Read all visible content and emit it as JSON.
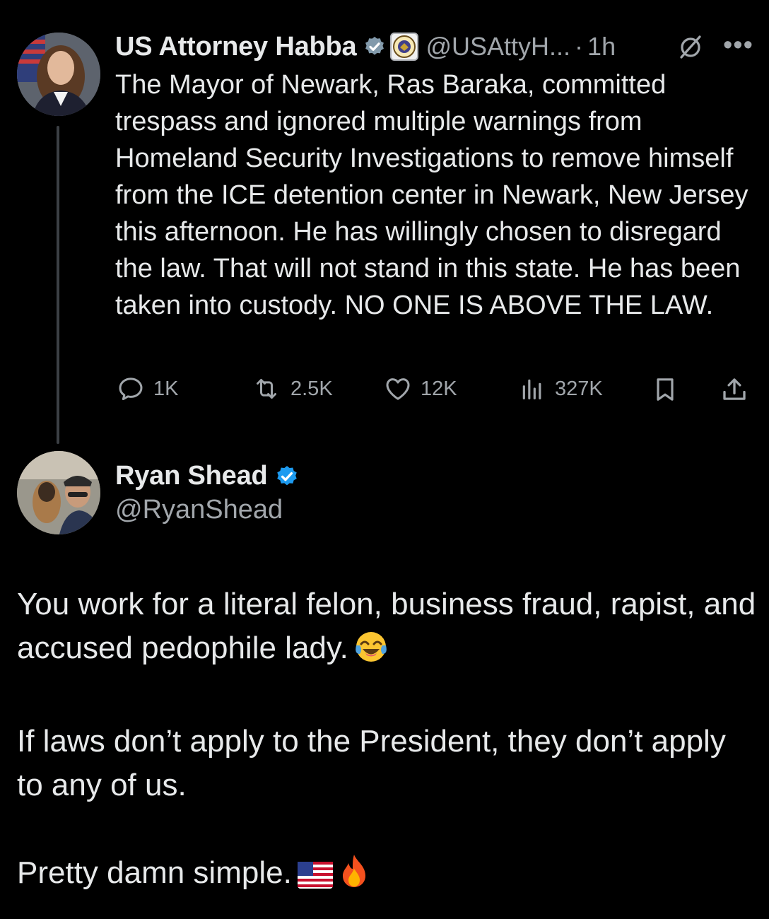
{
  "tweet": {
    "author_name": "US Attorney Habba",
    "handle": "@USAttyH...",
    "separator": "·",
    "time": "1h",
    "text": "The Mayor of Newark, Ras Baraka, committed trespass and ignored multiple warnings from Homeland Security Investigations to remove himself from the ICE detention center in Newark, New Jersey this afternoon.  He has willingly chosen to disregard the law. That will not stand in this state.  He has been taken into custody. NO ONE IS ABOVE THE LAW.",
    "stats": {
      "replies": "1K",
      "reposts": "2.5K",
      "likes": "12K",
      "views": "327K"
    }
  },
  "reply": {
    "author_name": "Ryan Shead",
    "handle": "@RyanShead",
    "paragraphs": [
      "You work for a literal felon, business fraud, rapist, and accused pedophile lady.",
      "If laws don’t apply to the President, they don’t apply to any of us.",
      "Pretty damn simple."
    ],
    "emojis": [
      "face-with-tears-of-joy",
      "us-flag",
      "fire"
    ]
  },
  "colors": {
    "background": "#000000",
    "text": "#e7e9ea",
    "secondary": "#a1a6ab",
    "verified": "#1d9bf0"
  }
}
